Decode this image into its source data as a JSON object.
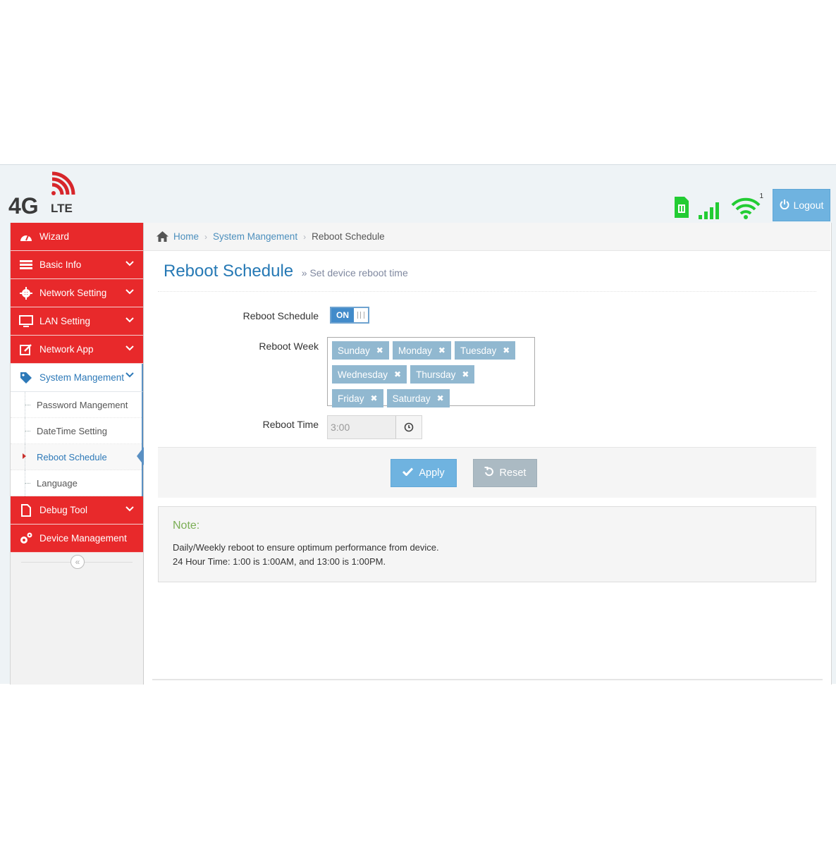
{
  "header": {
    "logo_main": "4G",
    "logo_sub": "LTE",
    "wifi_count": "1",
    "logout_label": "Logout"
  },
  "sidebar": {
    "items": [
      {
        "label": "Wizard"
      },
      {
        "label": "Basic Info"
      },
      {
        "label": "Network Setting"
      },
      {
        "label": "LAN Setting"
      },
      {
        "label": "Network App"
      },
      {
        "label": "System Mangement"
      },
      {
        "label": "Debug Tool"
      },
      {
        "label": "Device Management"
      }
    ],
    "submenu": [
      {
        "label": "Password Mangement"
      },
      {
        "label": "DateTime Setting"
      },
      {
        "label": "Reboot Schedule"
      },
      {
        "label": "Language"
      }
    ],
    "collapse_icon": "«"
  },
  "breadcrumb": {
    "home": "Home",
    "section": "System Mangement",
    "current": "Reboot Schedule"
  },
  "page": {
    "title": "Reboot Schedule",
    "subtitle": "Set device reboot time",
    "subtitle_prefix": "»"
  },
  "form": {
    "schedule_label": "Reboot Schedule",
    "toggle_on": "ON",
    "week_label": "Reboot Week",
    "days": [
      "Sunday",
      "Monday",
      "Tuesday",
      "Wednesday",
      "Thursday",
      "Friday",
      "Saturday"
    ],
    "time_label": "Reboot Time",
    "time_value": "3:00",
    "apply_label": "Apply",
    "reset_label": "Reset"
  },
  "note": {
    "title": "Note:",
    "line1": "Daily/Weekly reboot to ensure optimum performance from device.",
    "line2": "24 Hour Time: 1:00 is 1:00AM, and 13:00 is 1:00PM."
  },
  "colors": {
    "nav_red": "#e8292b",
    "accent_blue": "#2679b5",
    "signal_green": "#22cc33",
    "button_blue": "#6fb3e0",
    "button_grey": "#abbac3"
  }
}
